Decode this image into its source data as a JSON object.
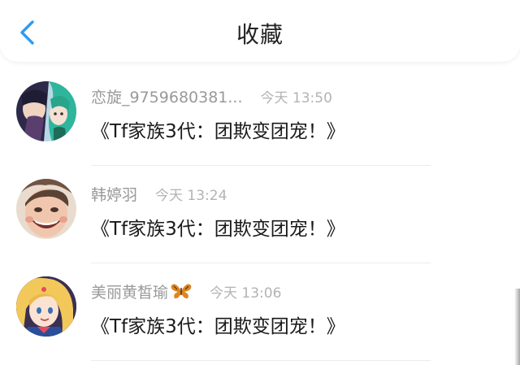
{
  "header": {
    "title": "收藏",
    "back_icon": "chevron-left-icon",
    "accent": "#2f9bf2"
  },
  "items": [
    {
      "username": "恋旋_9759680381...",
      "time": "今天 13:50",
      "content": "《Tf家族3代：团欺变团宠！》",
      "avatar_icon": "anime-couple-avatar"
    },
    {
      "username": "韩婷羽",
      "time": "今天 13:24",
      "content": "《Tf家族3代：团欺变团宠！》",
      "avatar_icon": "funny-face-avatar"
    },
    {
      "username": "美丽黄皙瑜",
      "time": "今天 13:06",
      "content": "《Tf家族3代：团欺变团宠！》",
      "avatar_icon": "sailor-moon-avatar",
      "badge_icon": "butterfly-icon"
    }
  ]
}
